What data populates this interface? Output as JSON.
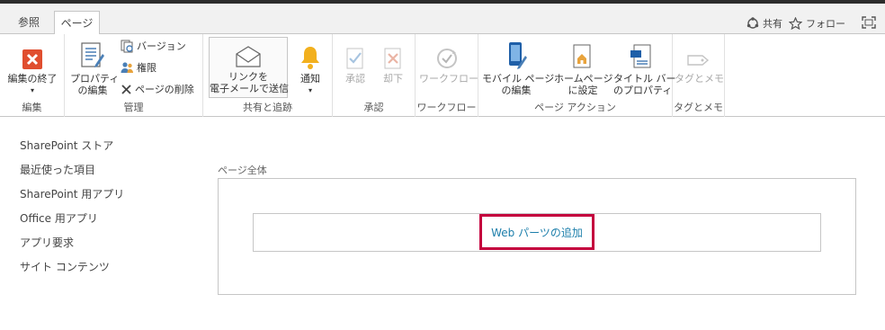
{
  "tabs": [
    {
      "label": "参照"
    },
    {
      "label": "ページ"
    }
  ],
  "top_actions": {
    "share": "共有",
    "follow": "フォロー"
  },
  "ribbon": {
    "groups": {
      "edit": "編集",
      "manage": "管理",
      "share_track": "共有と追跡",
      "approve": "承認",
      "workflow": "ワークフロー",
      "page_actions": "ページ アクション",
      "tags": "タグとメモ"
    },
    "buttons": {
      "stop_editing": "編集の終了",
      "edit_properties_l1": "プロパティ",
      "edit_properties_l2": "の編集",
      "versions": "バージョン",
      "permissions": "権限",
      "delete_page": "ページの削除",
      "email_link_l1": "リンクを",
      "email_link_l2": "電子メールで送信",
      "alert": "通知",
      "approve": "承認",
      "reject": "却下",
      "workflows": "ワークフロー",
      "edit_mobile_l1": "モバイル ページ",
      "edit_mobile_l2": "の編集",
      "make_homepage_l1": "ホームページ",
      "make_homepage_l2": "に設定",
      "title_bar_l1": "タイトル バー",
      "title_bar_l2": "のプロパティ",
      "tags_notes": "タグとメモ"
    }
  },
  "left_nav": [
    "SharePoint ストア",
    "最近使った項目",
    "SharePoint 用アプリ",
    "Office 用アプリ",
    "アプリ要求",
    "サイト コンテンツ"
  ],
  "zone": {
    "label": "ページ全体",
    "add_webpart": "Web パーツの追加"
  },
  "colors": {
    "accent_link": "#1d7fab",
    "highlight_border": "#c4003d",
    "stop_edit_icon": "#e04e2f"
  }
}
